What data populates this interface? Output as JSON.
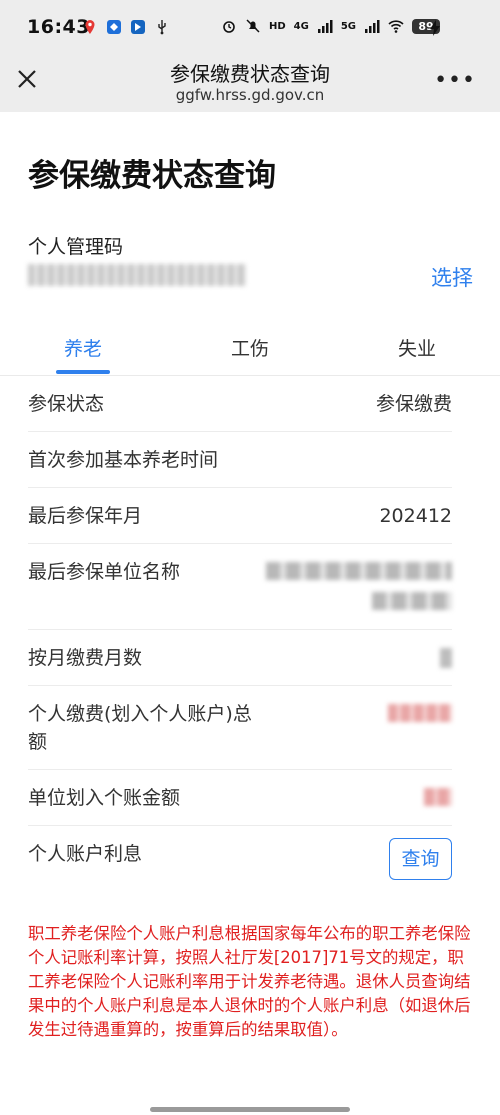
{
  "status_bar": {
    "time": "16:43",
    "network_5g": "5G",
    "network_4g": "4G",
    "hd_label": "HD",
    "battery": "89"
  },
  "nav": {
    "title": "参保缴费状态查询",
    "url": "ggfw.hrss.gd.gov.cn",
    "more": "•••"
  },
  "page": {
    "title": "参保缴费状态查询",
    "personal_code_label": "个人管理码",
    "choose_label": "选择"
  },
  "tabs": [
    {
      "label": "养老",
      "active": true
    },
    {
      "label": "工伤",
      "active": false
    },
    {
      "label": "失业",
      "active": false
    }
  ],
  "rows": {
    "status": {
      "label": "参保状态",
      "value": "参保缴费"
    },
    "first_time": {
      "label": "首次参加基本养老时间",
      "value": ""
    },
    "last_month": {
      "label": "最后参保年月",
      "value": "202412"
    },
    "last_unit": {
      "label": "最后参保单位名称"
    },
    "months": {
      "label": "按月缴费月数"
    },
    "personal_total": {
      "label": "个人缴费(划入个人账户)总额"
    },
    "unit_amount": {
      "label": "单位划入个账金额"
    },
    "interest": {
      "label": "个人账户利息",
      "button": "查询"
    }
  },
  "notice": "职工养老保险个人账户利息根据国家每年公布的职工养老保险个人记账利率计算，按照人社厅发[2017]71号文的规定，职工养老保险个人记账利率用于计发养老待遇。退休人员查询结果中的个人账户利息是本人退休时的个人账户利息（如退休后发生过待遇重算的，按重算后的结果取值）。",
  "colors": {
    "accent": "#2f80ed",
    "notice": "#e02020",
    "bar_bg": "#ededed"
  }
}
